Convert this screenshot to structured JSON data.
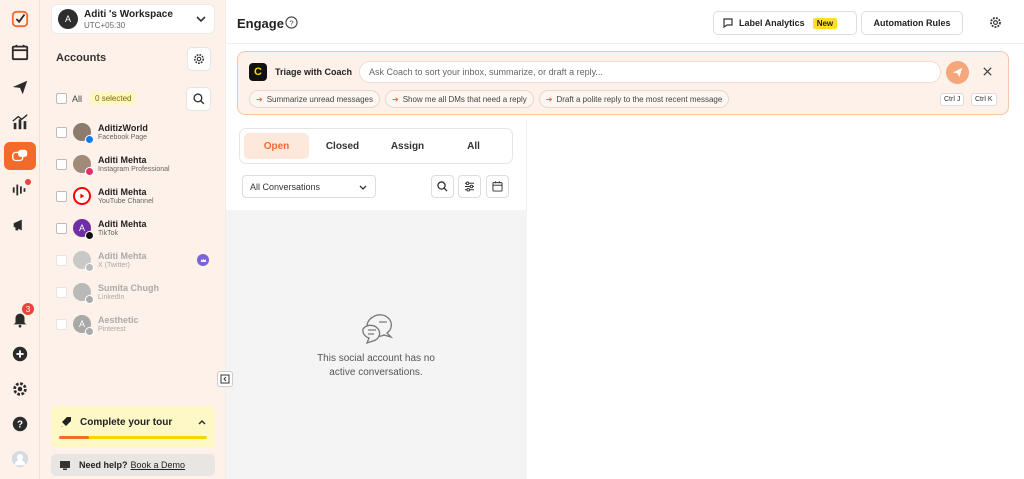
{
  "workspace": {
    "avatar_initial": "A",
    "name": "Aditi 's Workspace",
    "timezone": "UTC+05:30"
  },
  "sidebar": {
    "title": "Accounts",
    "all_label": "All",
    "selected_badge": "0 selected",
    "accounts": [
      {
        "name": "AditizWorld",
        "platform": "Facebook Page",
        "enabled": true
      },
      {
        "name": "Aditi Mehta",
        "platform": "Instagram Professional",
        "enabled": true
      },
      {
        "name": "Aditi Mehta",
        "platform": "YouTube Channel",
        "enabled": true
      },
      {
        "name": "Aditi Mehta",
        "platform": "TikTok",
        "enabled": true,
        "avatar_initial": "A"
      },
      {
        "name": "Aditi Mehta",
        "platform": "X (Twitter)",
        "enabled": false
      },
      {
        "name": "Sumita Chugh",
        "platform": "LinkedIn",
        "enabled": false
      },
      {
        "name": "Aesthetic",
        "platform": "Pinterest",
        "enabled": false,
        "avatar_initial": "A"
      }
    ],
    "tour": {
      "label": "Complete your tour",
      "progress": 0.2
    },
    "help": {
      "text": "Need help?",
      "link": "Book a Demo"
    }
  },
  "rail": {
    "notification_count": "3"
  },
  "header": {
    "title": "Engage",
    "label_analytics": "Label Analytics",
    "new_badge": "New",
    "automation_rules": "Automation Rules"
  },
  "coach": {
    "logo": "C",
    "title": "Triage with Coach",
    "placeholder": "Ask Coach to sort your inbox, summarize, or draft a reply...",
    "chips": [
      "Summarize unread messages",
      "Show me all DMs that need a reply",
      "Draft a polite reply to the most recent message"
    ],
    "shortcut_1": "Ctrl J",
    "shortcut_2": "Ctrl K"
  },
  "conversations": {
    "tabs": [
      "Open",
      "Closed",
      "Assign",
      "All"
    ],
    "active_tab": "Open",
    "filter": "All Conversations",
    "empty_line_1": "This social account has no",
    "empty_line_2": "active conversations."
  },
  "colors": {
    "accent": "#f26b2a",
    "sidebar_bg": "#fdf1e9",
    "tour_bg": "#fdf8c6"
  }
}
